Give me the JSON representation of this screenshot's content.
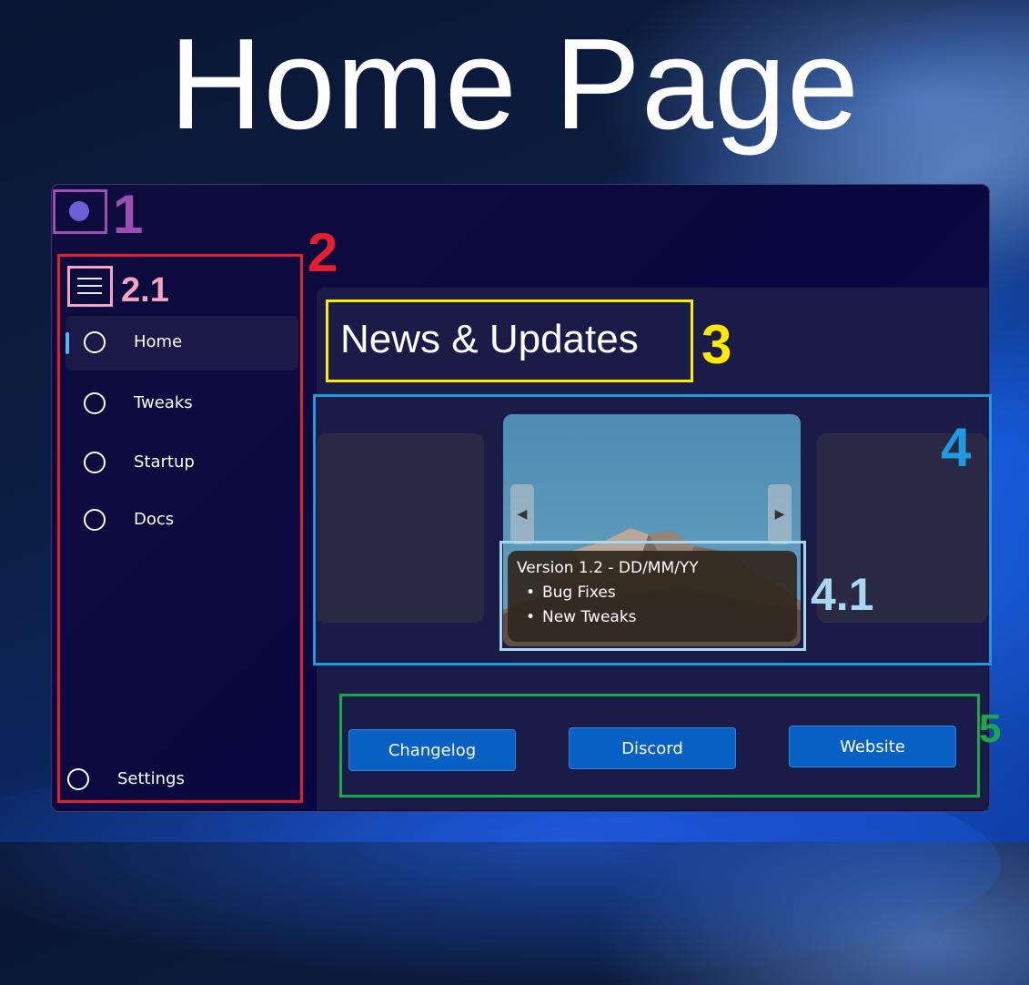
{
  "page": {
    "title": "Home Page"
  },
  "annotations": {
    "1": "1",
    "2": "2",
    "2_1": "2.1",
    "3": "3",
    "4": "4",
    "4_1": "4.1",
    "5": "5"
  },
  "colors": {
    "annotation_1": "#9b4fb3",
    "annotation_2": "#e41e2c",
    "annotation_2_1": "#f4a4c0",
    "annotation_3": "#ffea00",
    "annotation_4": "#1f9ae0",
    "annotation_4_1": "#a7d8ef",
    "annotation_5": "#1aa84b",
    "accent": "#0760c4",
    "nav_indicator": "#5bb3f5"
  },
  "app": {
    "icon": "app-dot-icon",
    "sidebar": {
      "menu_icon": "hamburger-icon",
      "items": [
        {
          "label": "Home",
          "icon": "circle-icon",
          "active": true
        },
        {
          "label": "Tweaks",
          "icon": "circle-icon",
          "active": false
        },
        {
          "label": "Startup",
          "icon": "circle-icon",
          "active": false
        },
        {
          "label": "Docs",
          "icon": "circle-icon",
          "active": false
        }
      ],
      "settings": {
        "label": "Settings",
        "icon": "circle-icon"
      }
    },
    "main": {
      "heading": "News & Updates",
      "carousel": {
        "prev_icon": "triangle-left-icon",
        "next_icon": "triangle-right-icon",
        "current": {
          "title": "Version 1.2 - DD/MM/YY",
          "items": [
            "Bug Fixes",
            "New Tweaks"
          ]
        }
      },
      "buttons": {
        "changelog": "Changelog",
        "discord": "Discord",
        "website": "Website"
      }
    }
  }
}
